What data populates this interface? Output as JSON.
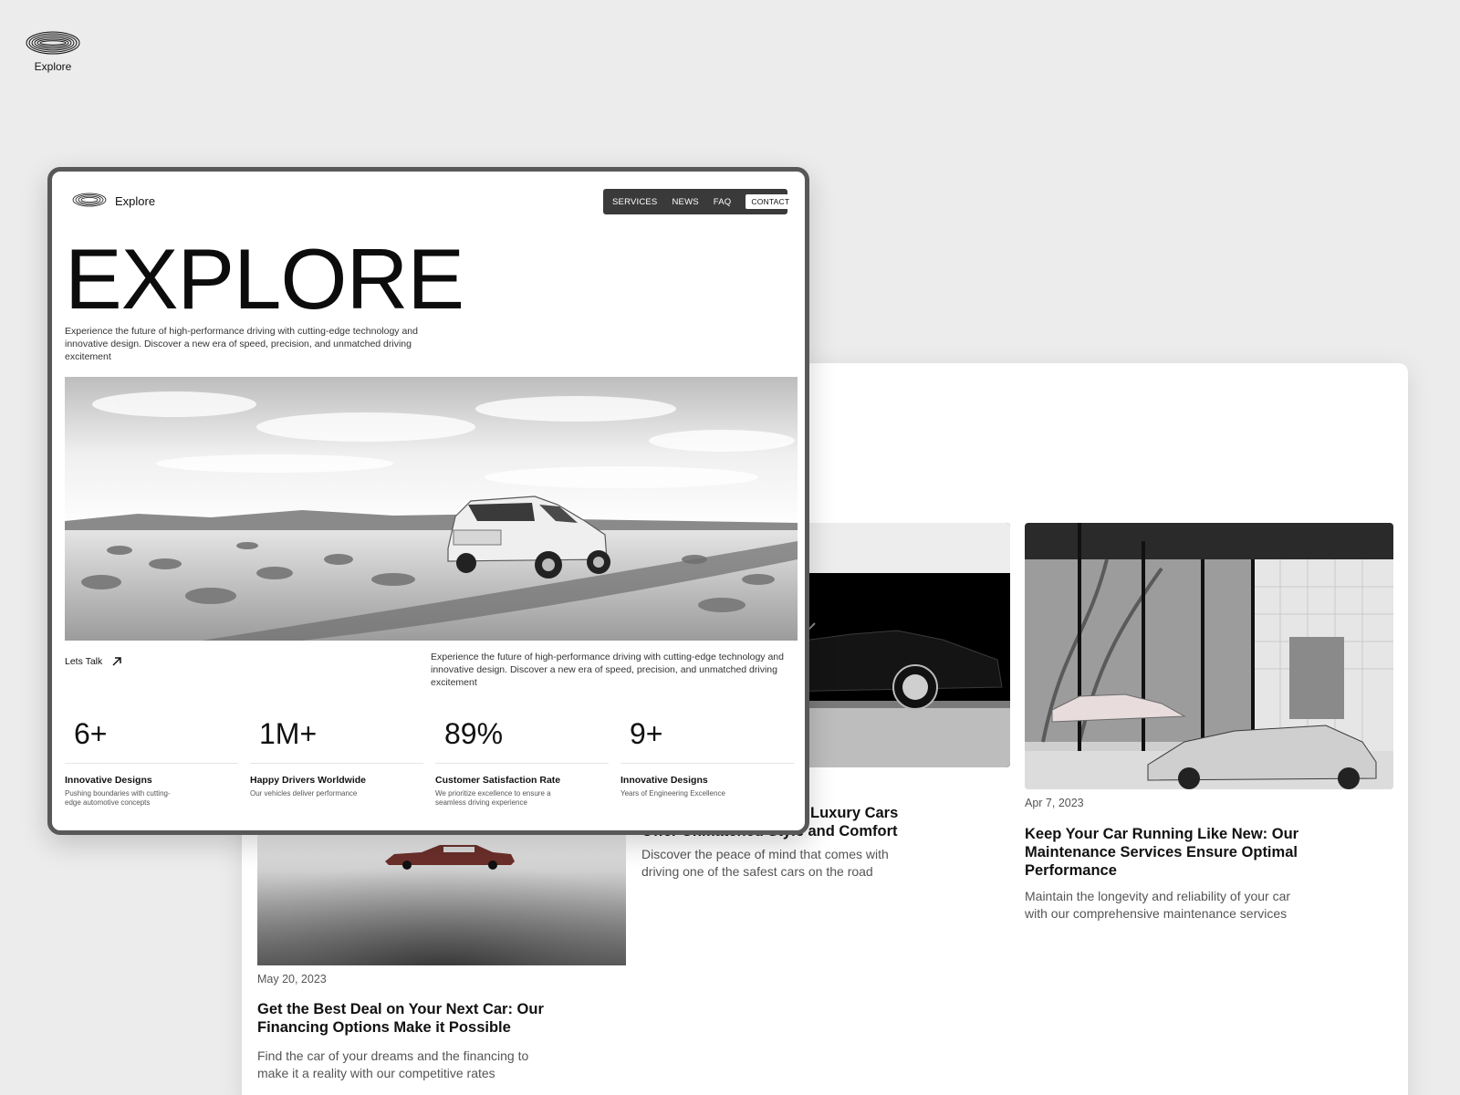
{
  "brand": {
    "name": "Explore",
    "logo_icon": "oval-logo-icon"
  },
  "landing": {
    "brand_name": "Explore",
    "nav": [
      {
        "label": "SERVICES"
      },
      {
        "label": "NEWS"
      },
      {
        "label": "FAQ"
      },
      {
        "label": "CONTACT"
      }
    ],
    "hero_title": "EXPLORE",
    "hero_description": "Experience the future of high-performance driving with cutting-edge technology and innovative design. Discover a new era of speed, precision, and unmatched driving excitement",
    "cta_label": "Lets Talk",
    "secondary_description": "Experience the future of high-performance driving with cutting-edge technology and innovative design. Discover a new era of speed, precision, and unmatched driving excitement",
    "stats": [
      {
        "value": "6+",
        "label": "Innovative Designs",
        "sub": "Pushing boundaries with cutting-edge automotive concepts"
      },
      {
        "value": "1M+",
        "label": "Happy Drivers Worldwide",
        "sub": "Our vehicles deliver performance"
      },
      {
        "value": "89%",
        "label": "Customer Satisfaction Rate",
        "sub": "We prioritize excellence to ensure a seamless driving experience"
      },
      {
        "value": "9+",
        "label": "Innovative Designs",
        "sub": "Years of Engineering Excellence"
      }
    ]
  },
  "news": {
    "posts": [
      {
        "date": "May 20, 2023",
        "title": "Get the Best Deal on Your Next Car: Our Financing Options Make it Possible",
        "description": "Find the car of your dreams and the financing to make it a reality with our competitive rates"
      },
      {
        "date": "",
        "title": "Luxury Cars Offer Unmatched Style and Comfort",
        "title_line1": "Luxury Cars",
        "title_line2": "Offer Unmatched Style and Comfort",
        "description": "Discover the peace of mind that comes with driving one of the safest cars on the road"
      },
      {
        "date": "Apr 7, 2023",
        "title": "Keep Your Car Running Like New: Our Maintenance Services Ensure Optimal Performance",
        "description": "Maintain the longevity and reliability of your car with our comprehensive maintenance services"
      }
    ]
  },
  "colors": {
    "background": "#ececec",
    "nav_bg": "#3a3a3a",
    "frame": "#585858",
    "text": "#111111"
  }
}
